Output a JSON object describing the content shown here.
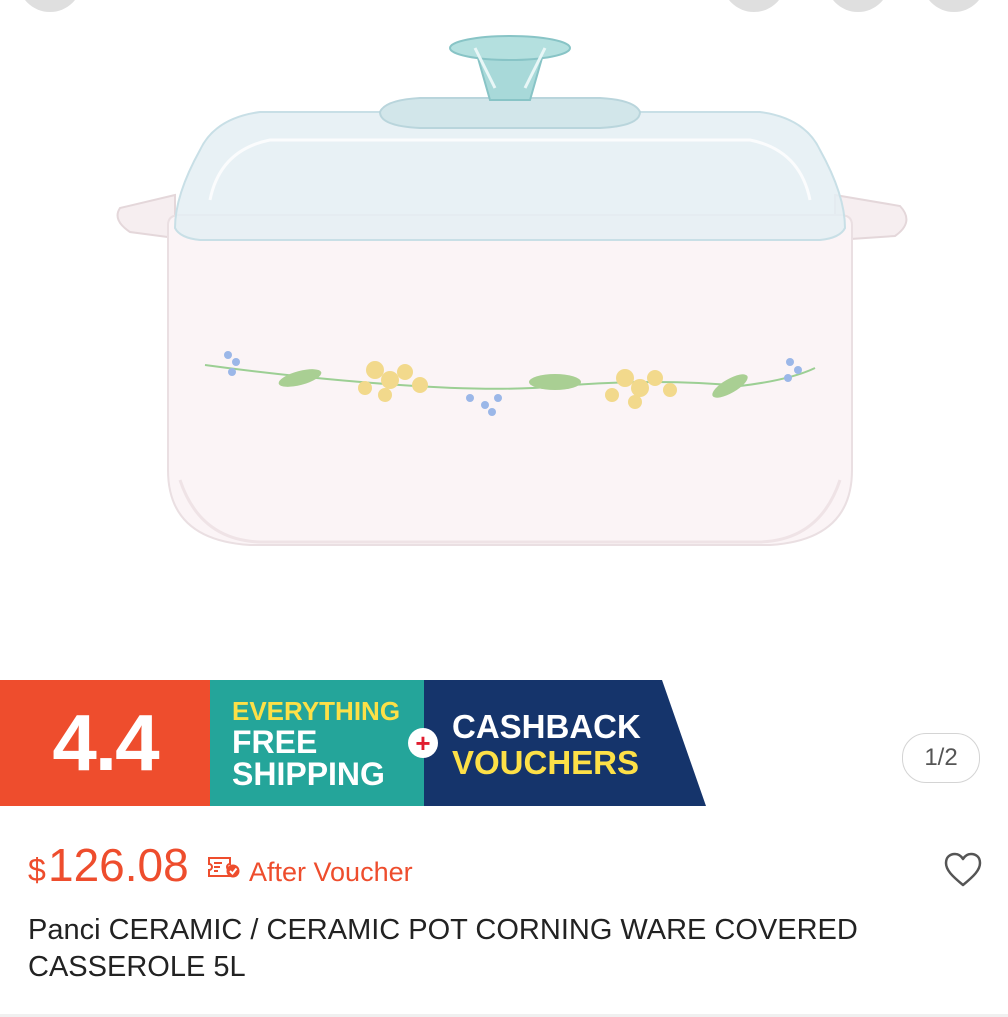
{
  "banner": {
    "promo_number": "4.4",
    "shipping_line1": "EVERYTHING",
    "shipping_line2": "FREE",
    "shipping_line3": "SHIPPING",
    "plus_symbol": "+",
    "cashback_line1": "CASHBACK",
    "cashback_line2": "VOUCHERS",
    "colors": {
      "orange": "#ee4d2d",
      "teal": "#24a59a",
      "navy": "#15346b",
      "yellow": "#fde047"
    }
  },
  "gallery": {
    "counter": "1/2"
  },
  "product": {
    "currency": "$",
    "price": "126.08",
    "voucher_label": "After Voucher",
    "voucher_icon": "voucher-check-icon",
    "favorite_icon": "heart-outline-icon",
    "title": "Panci CERAMIC / CERAMIC POT CORNING WARE COVERED CASSEROLE 5L",
    "accent_color": "#ee4d2d"
  }
}
